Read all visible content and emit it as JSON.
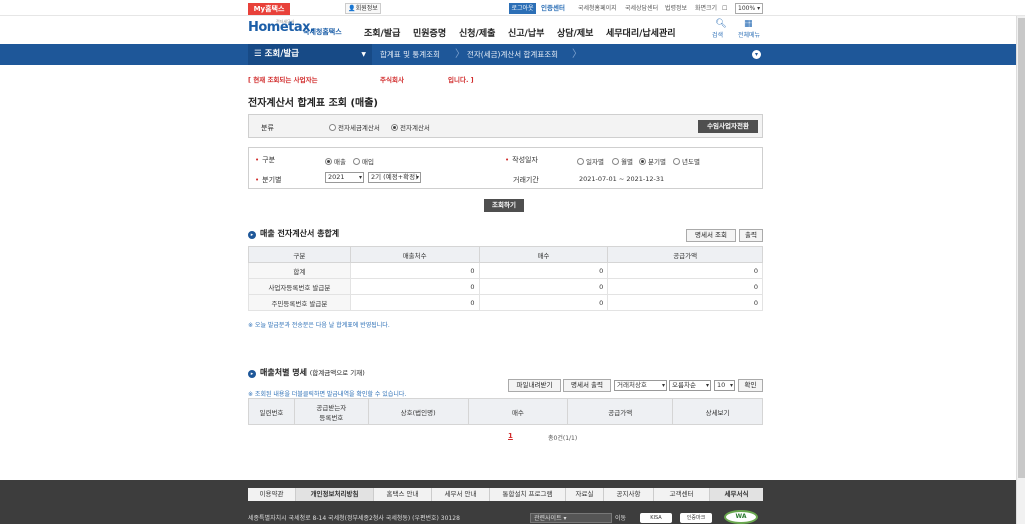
{
  "topbar": {
    "my_hometax": "My홈택스",
    "member_info": "회원정보",
    "logout": "로그아웃",
    "auth_center": "인증센터",
    "links": [
      "국세청홈페이지",
      "국세상담센터",
      "법령정보",
      "화면크기"
    ],
    "zoom": "100%"
  },
  "header": {
    "logo_text": "Hometax.",
    "logo_sub": "국세청홈택스",
    "logo_tiny": "전자세무서",
    "menu": [
      "조회/발급",
      "민원증명",
      "신청/제출",
      "신고/납부",
      "상담/제보",
      "세무대리/납세관리"
    ],
    "search_label": "검색",
    "allmenu_label": "전체메뉴"
  },
  "navbar": {
    "main": "조회/발급",
    "crumb1": "합계표 및 통계조회",
    "crumb2": "전자(세금)계산서 합계표조회"
  },
  "notice": {
    "prefix": "[ 현재 조회되는 사업자는",
    "company": "주식회사",
    "suffix": "입니다. ]"
  },
  "page_title": "전자계산서 합계표 조회 (매출)",
  "classification": {
    "label": "분류",
    "options": [
      "전자세금계산서",
      "전자계산서"
    ],
    "selected": "전자계산서",
    "switch_button": "수임사업자전환"
  },
  "search_form": {
    "type_label": "구분",
    "type_options": [
      "매출",
      "매입"
    ],
    "type_selected": "매출",
    "date_label": "작성일자",
    "date_options": [
      "일자별",
      "월별",
      "분기별",
      "년도별"
    ],
    "date_selected": "분기별",
    "quarter_label": "분기별",
    "year_value": "2021",
    "quarter_value": "2기 (예정+확정)",
    "period_label": "거래기간",
    "period_value": "2021-07-01 ~ 2021-12-31",
    "search_button": "조회하기"
  },
  "summary": {
    "title": "매출 전자계산서 총합계",
    "detail_button": "명세서 조회",
    "print_button": "출력",
    "headers": [
      "구분",
      "매출처수",
      "매수",
      "공급가액"
    ],
    "rows": [
      {
        "label": "합계",
        "v1": "0",
        "v2": "0",
        "v3": "0"
      },
      {
        "label": "사업자등록번호 발급분",
        "v1": "0",
        "v2": "0",
        "v3": "0"
      },
      {
        "label": "주민등록번호 발급분",
        "v1": "0",
        "v2": "0",
        "v3": "0"
      }
    ],
    "note": "※ 오늘 발급분과 전송분은 다음 날 합계표에 반영됩니다."
  },
  "detail": {
    "title": "매출처별 명세",
    "title_sub": "(합계금액으로 기재)",
    "note": "※ 조회된 내용을 더블클릭하면 발급내역을 확인할 수 있습니다.",
    "download_button": "파일내려받기",
    "print_button": "명세서 출력",
    "sort_field": "거래처상호",
    "sort_order": "오름차순",
    "page_size": "10",
    "confirm_button": "확인",
    "headers": [
      "일련번호",
      "공급받는자\n등록번호",
      "상호(법인명)",
      "매수",
      "공급가액",
      "상세보기"
    ],
    "pagination_current": "1",
    "total_count": "총0건(1/1)"
  },
  "footer": {
    "menu": [
      "이용약관",
      "개인정보처리방침",
      "홈택스 안내",
      "세무서 안내",
      "통합설치 프로그램",
      "자료실",
      "공지사항",
      "고객센터",
      "세무서식"
    ],
    "address": "세종특별자치시 국세청로 8-14 국세청(정부세종2청사 국세청동) (우편번호) 30128",
    "related_sites": "관련사이트",
    "move": "이동",
    "badges": [
      "KISA",
      "인증마크"
    ],
    "wa_mark": "WA"
  }
}
